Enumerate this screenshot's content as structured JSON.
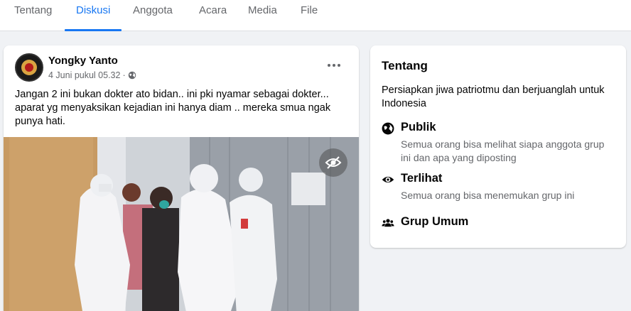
{
  "tabs": [
    {
      "label": "Tentang",
      "active": false
    },
    {
      "label": "Diskusi",
      "active": true
    },
    {
      "label": "Anggota",
      "active": false
    },
    {
      "label": "Acara",
      "active": false
    },
    {
      "label": "Media",
      "active": false
    },
    {
      "label": "File",
      "active": false
    }
  ],
  "post": {
    "author": "Yongky Yanto",
    "timestamp": "4 Juni pukul 05.32",
    "separator": "·",
    "privacy_icon": "globe-icon",
    "text": "Jangan 2 ini bukan dokter ato bidan.. ini pki nyamar sebagai dokter... aparat yg menyaksikan kejadian ini hanya diam .. mereka smua ngak punya hati.",
    "media_overlay_icon": "eye-slash-icon"
  },
  "about": {
    "title": "Tentang",
    "description": "Persiapkan jiwa patriotmu dan berjuanglah untuk Indonesia",
    "items": [
      {
        "icon": "globe-icon",
        "label": "Publik",
        "sub": "Semua orang bisa melihat siapa anggota grup ini dan apa yang diposting"
      },
      {
        "icon": "eye-icon",
        "label": "Terlihat",
        "sub": "Semua orang bisa menemukan grup ini"
      },
      {
        "icon": "people-icon",
        "label": "Grup Umum",
        "sub": ""
      }
    ]
  },
  "colors": {
    "accent": "#1877f2",
    "background": "#f0f2f5",
    "secondary_text": "#65676b"
  }
}
